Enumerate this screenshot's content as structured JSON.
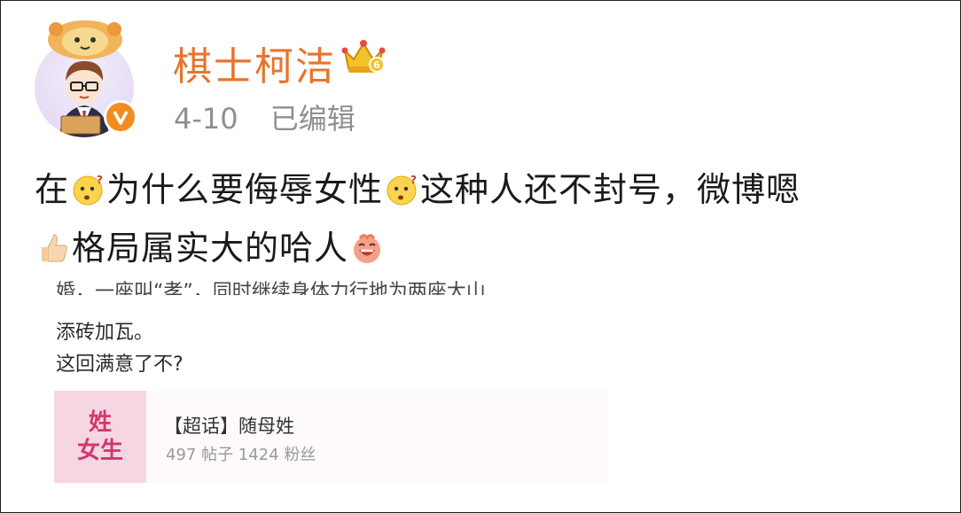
{
  "user": {
    "name": "棋士柯洁",
    "date": "4-10",
    "edited": "已编辑",
    "verified_badge": "V",
    "badge_color": "#f28c1f",
    "name_color": "#e8742c"
  },
  "post": {
    "seg1": "在",
    "seg2": "为什么要侮辱女性",
    "seg3": "这种人还不封号，微博嗯",
    "seg4": "格局属实大的哈人",
    "emojis": [
      "thinking-face-icon",
      "thinking-face-icon",
      "thumbs-up-icon",
      "laughing-face-icon"
    ]
  },
  "embedded": {
    "cut_line": "婚，一座叫“孝”，同时继续身体力行地为两座大山",
    "line2": "添砖加瓦。",
    "line3": "这回满意了不?",
    "topic": {
      "thumb_line1": "姓",
      "thumb_line2": "女生",
      "title": "【超话】随母姓",
      "stats": "497 帖子 1424 粉丝"
    }
  }
}
